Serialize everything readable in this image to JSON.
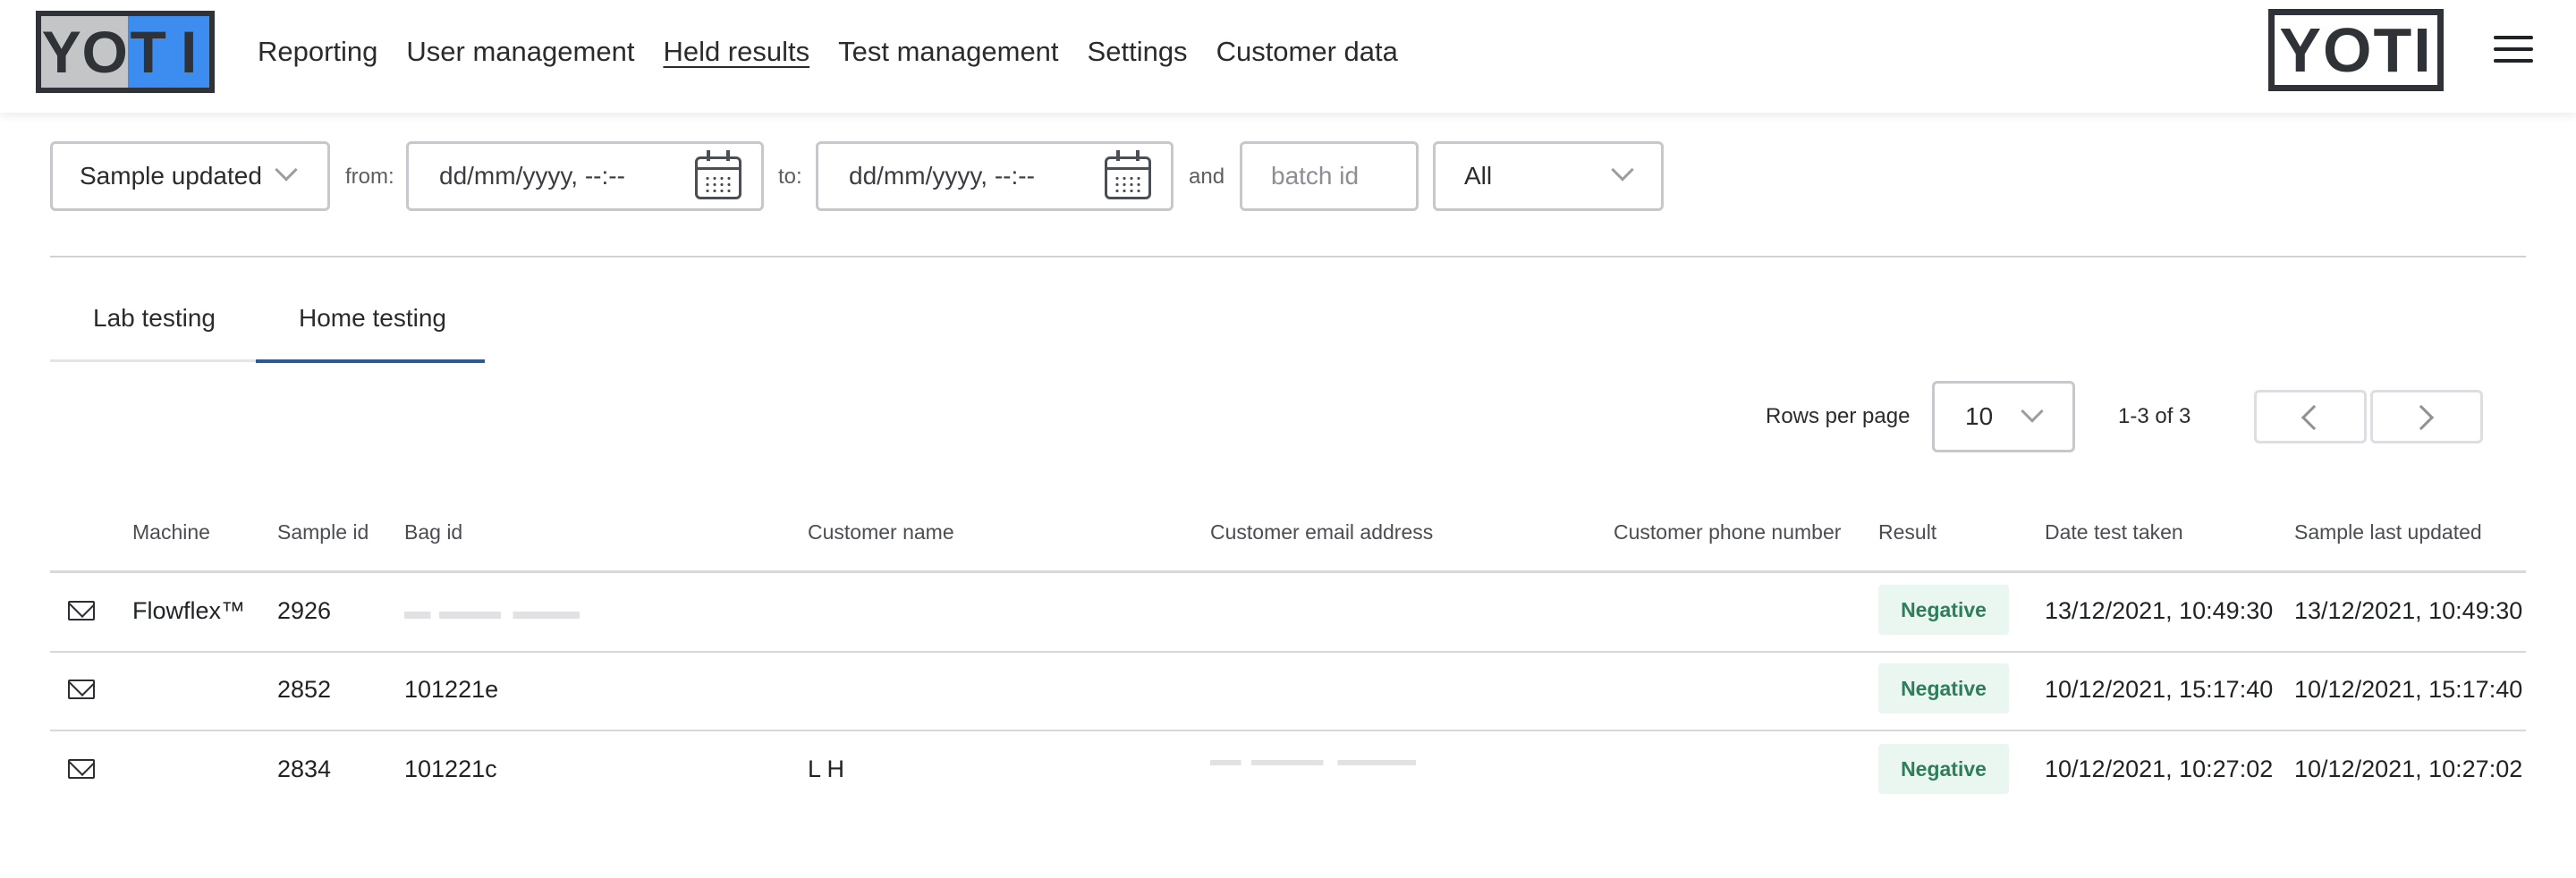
{
  "header": {
    "logo_text": "YOTI",
    "nav": [
      "Reporting",
      "User management",
      "Held results",
      "Test management",
      "Settings",
      "Customer data"
    ],
    "active_nav": "Held results"
  },
  "filters": {
    "date_type": "Sample updated",
    "from_label": "from:",
    "from_placeholder": "dd/mm/yyyy, --:--",
    "to_label": "to:",
    "to_placeholder": "dd/mm/yyyy, --:--",
    "and_label": "and",
    "batch_placeholder": "batch id",
    "status": "All"
  },
  "tabs": {
    "items": [
      "Lab testing",
      "Home testing"
    ],
    "active": "Home testing"
  },
  "pagination": {
    "rows_per_page_label": "Rows per page",
    "rows_per_page": "10",
    "range": "1-3 of 3"
  },
  "table": {
    "columns": [
      "Machine",
      "Sample id",
      "Bag id",
      "Customer name",
      "Customer email address",
      "Customer phone number",
      "Result",
      "Date test taken",
      "Sample last updated"
    ],
    "rows": [
      {
        "machine": "Flowflex™",
        "sample_id": "2926",
        "bag_id": "",
        "customer_name": "",
        "email": "",
        "phone": "",
        "result": "Negative",
        "date_taken": "13/12/2021, 10:49:30",
        "last_updated": "13/12/2021, 10:49:30"
      },
      {
        "machine": "",
        "sample_id": "2852",
        "bag_id": "101221e",
        "customer_name": "",
        "email": "",
        "phone": "",
        "result": "Negative",
        "date_taken": "10/12/2021, 15:17:40",
        "last_updated": "10/12/2021, 15:17:40"
      },
      {
        "machine": "",
        "sample_id": "2834",
        "bag_id": "101221c",
        "customer_name": "L H",
        "email": "",
        "phone": "",
        "result": "Negative",
        "date_taken": "10/12/2021, 10:27:02",
        "last_updated": "10/12/2021, 10:27:02"
      }
    ]
  },
  "colors": {
    "brand_blue": "#3d8cef",
    "tab_active": "#2a5b96",
    "negative_bg": "#e9f7f0",
    "negative_text": "#2e7d5b"
  }
}
